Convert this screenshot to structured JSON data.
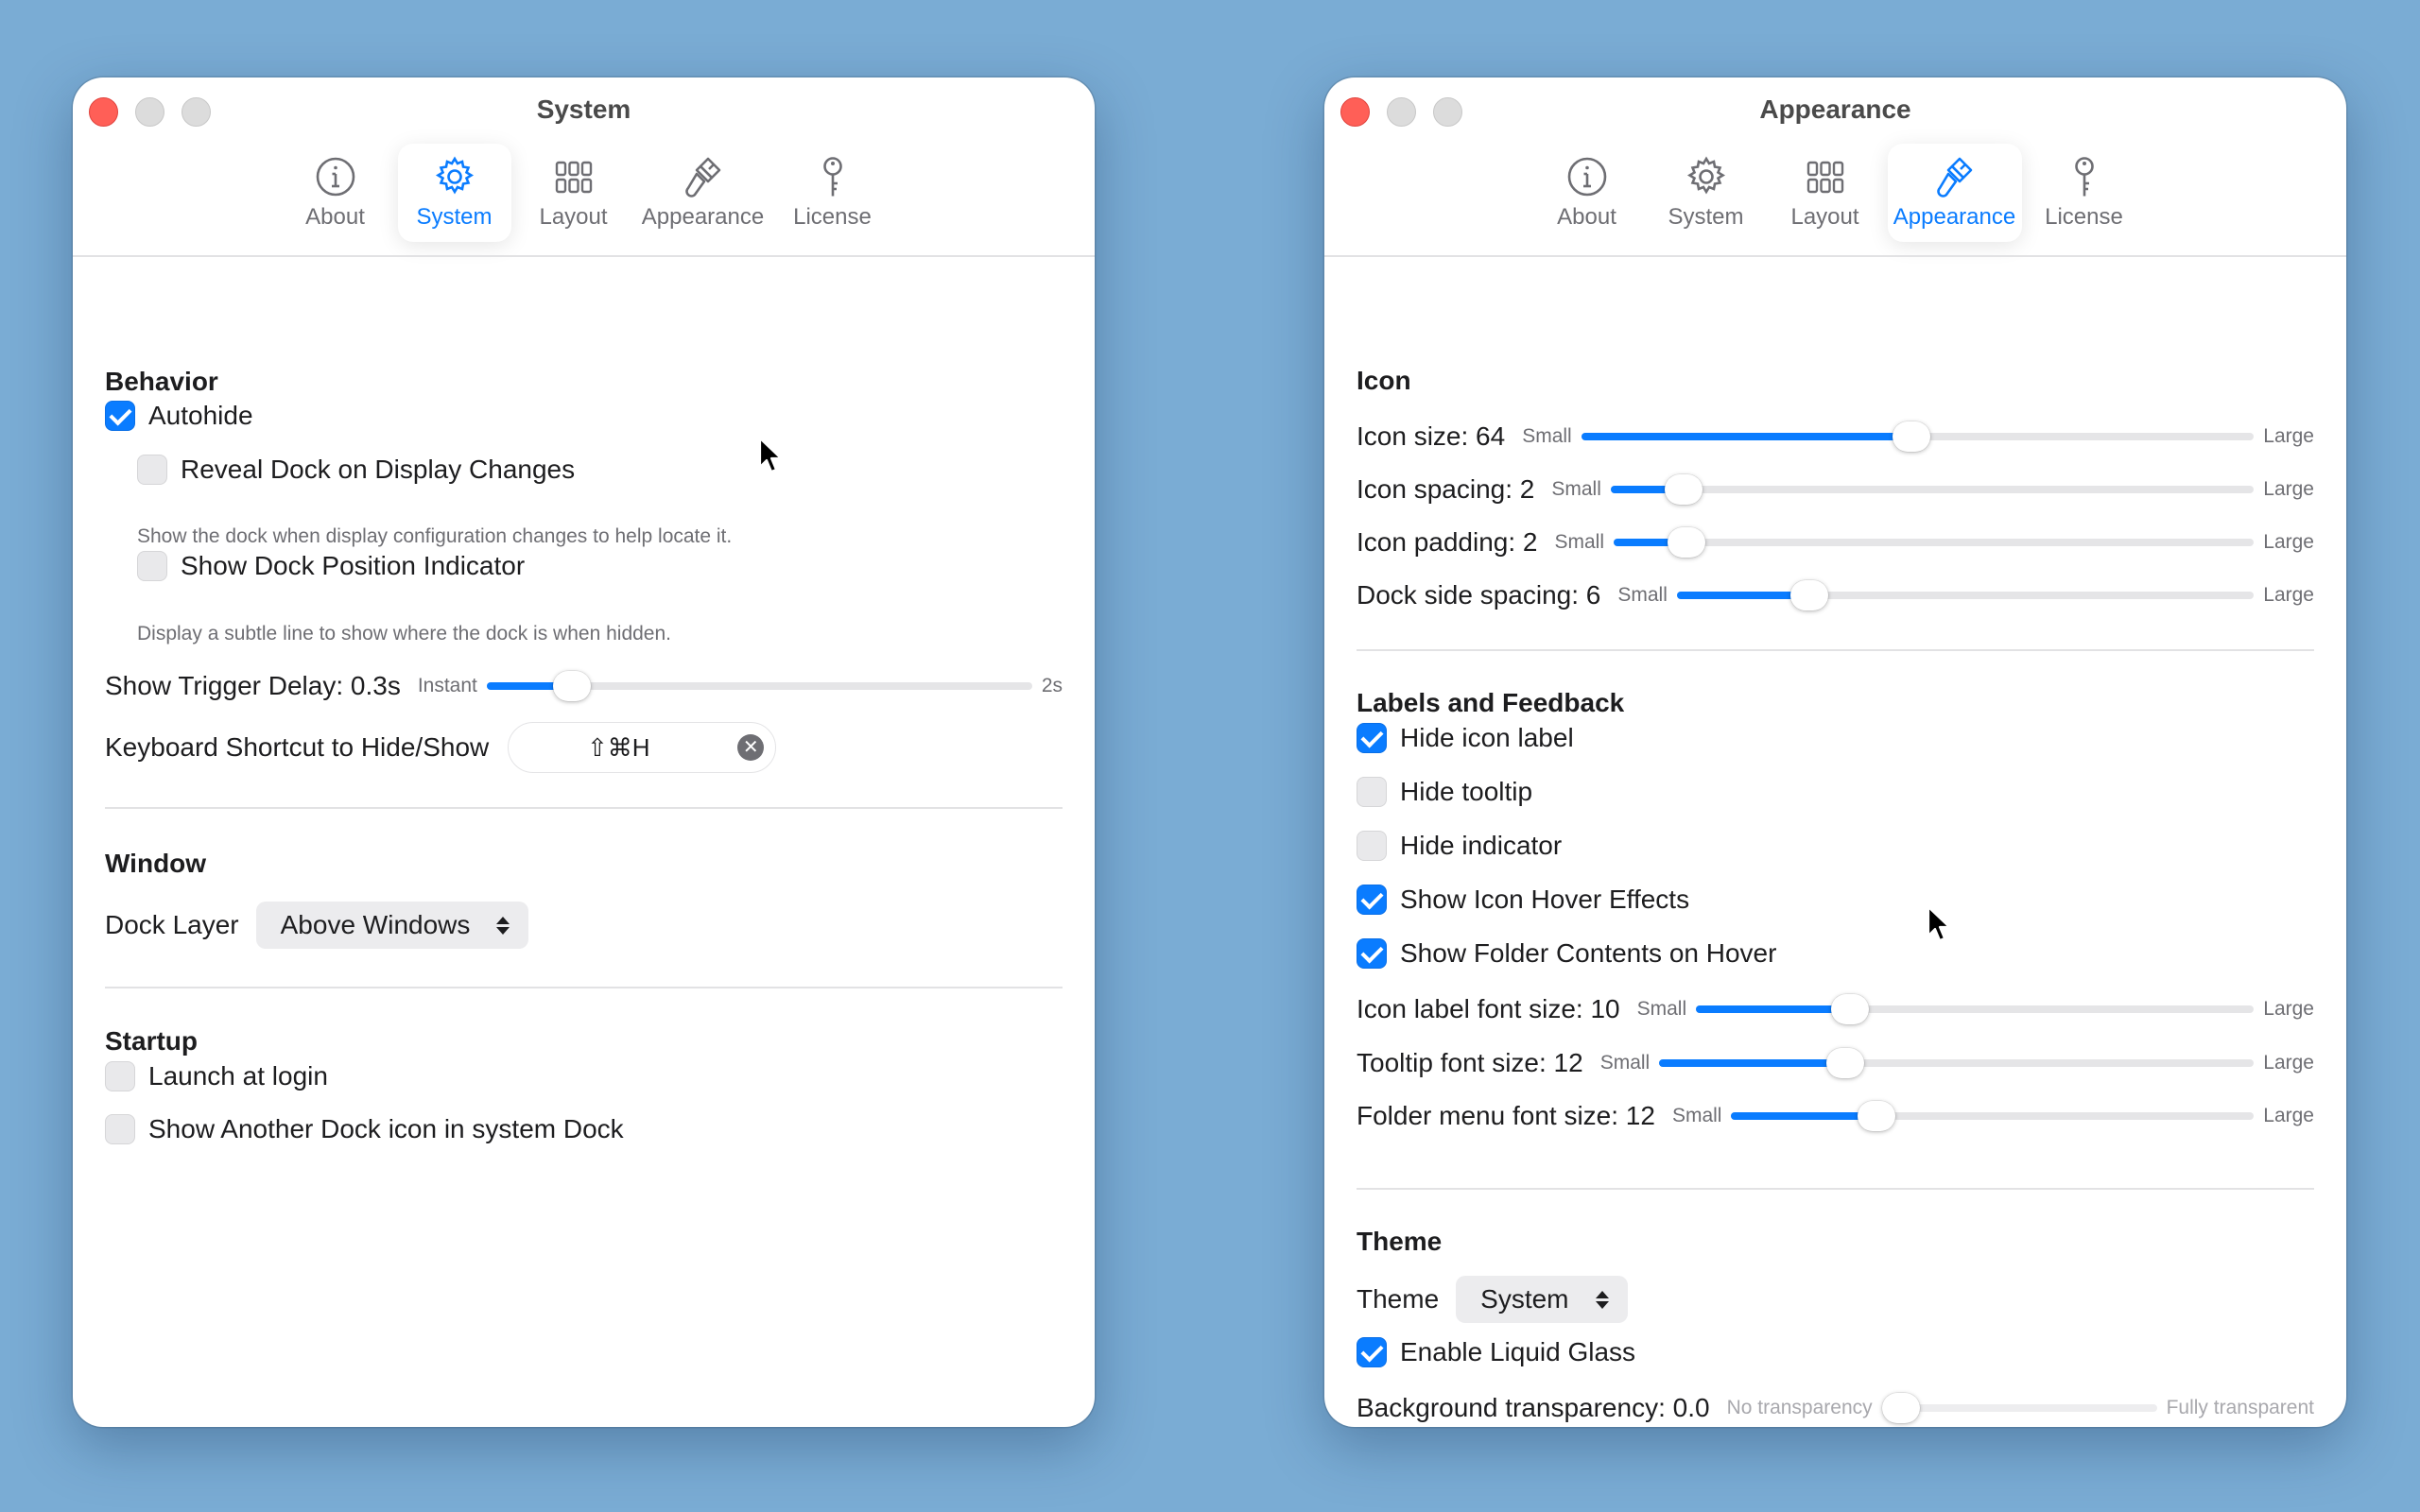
{
  "tabs": [
    {
      "label": "About",
      "icon": "info-icon"
    },
    {
      "label": "System",
      "icon": "gear-icon"
    },
    {
      "label": "Layout",
      "icon": "grid-icon"
    },
    {
      "label": "Appearance",
      "icon": "paintbrush-icon"
    },
    {
      "label": "License",
      "icon": "key-icon"
    }
  ],
  "accent_color": "#0a7cff",
  "system_window": {
    "title": "System",
    "active_tab": "System",
    "behavior": {
      "title": "Behavior",
      "autohide": {
        "label": "Autohide",
        "checked": true
      },
      "reveal": {
        "label": "Reveal Dock on Display Changes",
        "checked": false,
        "help": "Show the dock when display configuration changes to help locate it."
      },
      "indicator": {
        "label": "Show Dock Position Indicator",
        "checked": false,
        "help": "Display a subtle line to show where the dock is when hidden."
      },
      "trigger_delay": {
        "label": "Show Trigger Delay: 0.3s",
        "min_label": "Instant",
        "max_label": "2s",
        "value_fraction": 0.13
      },
      "shortcut": {
        "label": "Keyboard Shortcut to Hide/Show",
        "value": "⇧⌘H"
      }
    },
    "window": {
      "title": "Window",
      "dock_layer": {
        "label": "Dock Layer",
        "value": "Above Windows"
      }
    },
    "startup": {
      "title": "Startup",
      "launch_at_login": {
        "label": "Launch at login",
        "checked": false
      },
      "show_another": {
        "label": "Show Another Dock icon in system Dock",
        "checked": false
      }
    }
  },
  "appearance_window": {
    "title": "Appearance",
    "active_tab": "Appearance",
    "icon": {
      "title": "Icon",
      "sliders": [
        {
          "label": "Icon size: 64",
          "min_label": "Small",
          "max_label": "Large",
          "value_fraction": 0.49
        },
        {
          "label": "Icon spacing: 2",
          "min_label": "Small",
          "max_label": "Large",
          "value_fraction": 0.09
        },
        {
          "label": "Icon padding: 2",
          "min_label": "Small",
          "max_label": "Large",
          "value_fraction": 0.09
        },
        {
          "label": "Dock side spacing: 6",
          "min_label": "Small",
          "max_label": "Large",
          "value_fraction": 0.21
        }
      ]
    },
    "labels": {
      "title": "Labels and Feedback",
      "checks": [
        {
          "label": "Hide icon label",
          "checked": true
        },
        {
          "label": "Hide tooltip",
          "checked": false
        },
        {
          "label": "Hide indicator",
          "checked": false
        },
        {
          "label": "Show Icon Hover Effects",
          "checked": true
        },
        {
          "label": "Show Folder Contents on Hover",
          "checked": true
        }
      ],
      "sliders": [
        {
          "label": "Icon label font size: 10",
          "min_label": "Small",
          "max_label": "Large",
          "value_fraction": 0.26
        },
        {
          "label": "Tooltip font size: 12",
          "min_label": "Small",
          "max_label": "Large",
          "value_fraction": 0.3
        },
        {
          "label": "Folder menu font size: 12",
          "min_label": "Small",
          "max_label": "Large",
          "value_fraction": 0.26
        }
      ]
    },
    "theme": {
      "title": "Theme",
      "theme_select": {
        "label": "Theme",
        "value": "System"
      },
      "liquid_glass": {
        "label": "Enable Liquid Glass",
        "checked": true
      },
      "transparency": {
        "label": "Background transparency: 0.0",
        "min_label": "No transparency",
        "max_label": "Fully transparent",
        "value_fraction": 0.0
      }
    }
  }
}
